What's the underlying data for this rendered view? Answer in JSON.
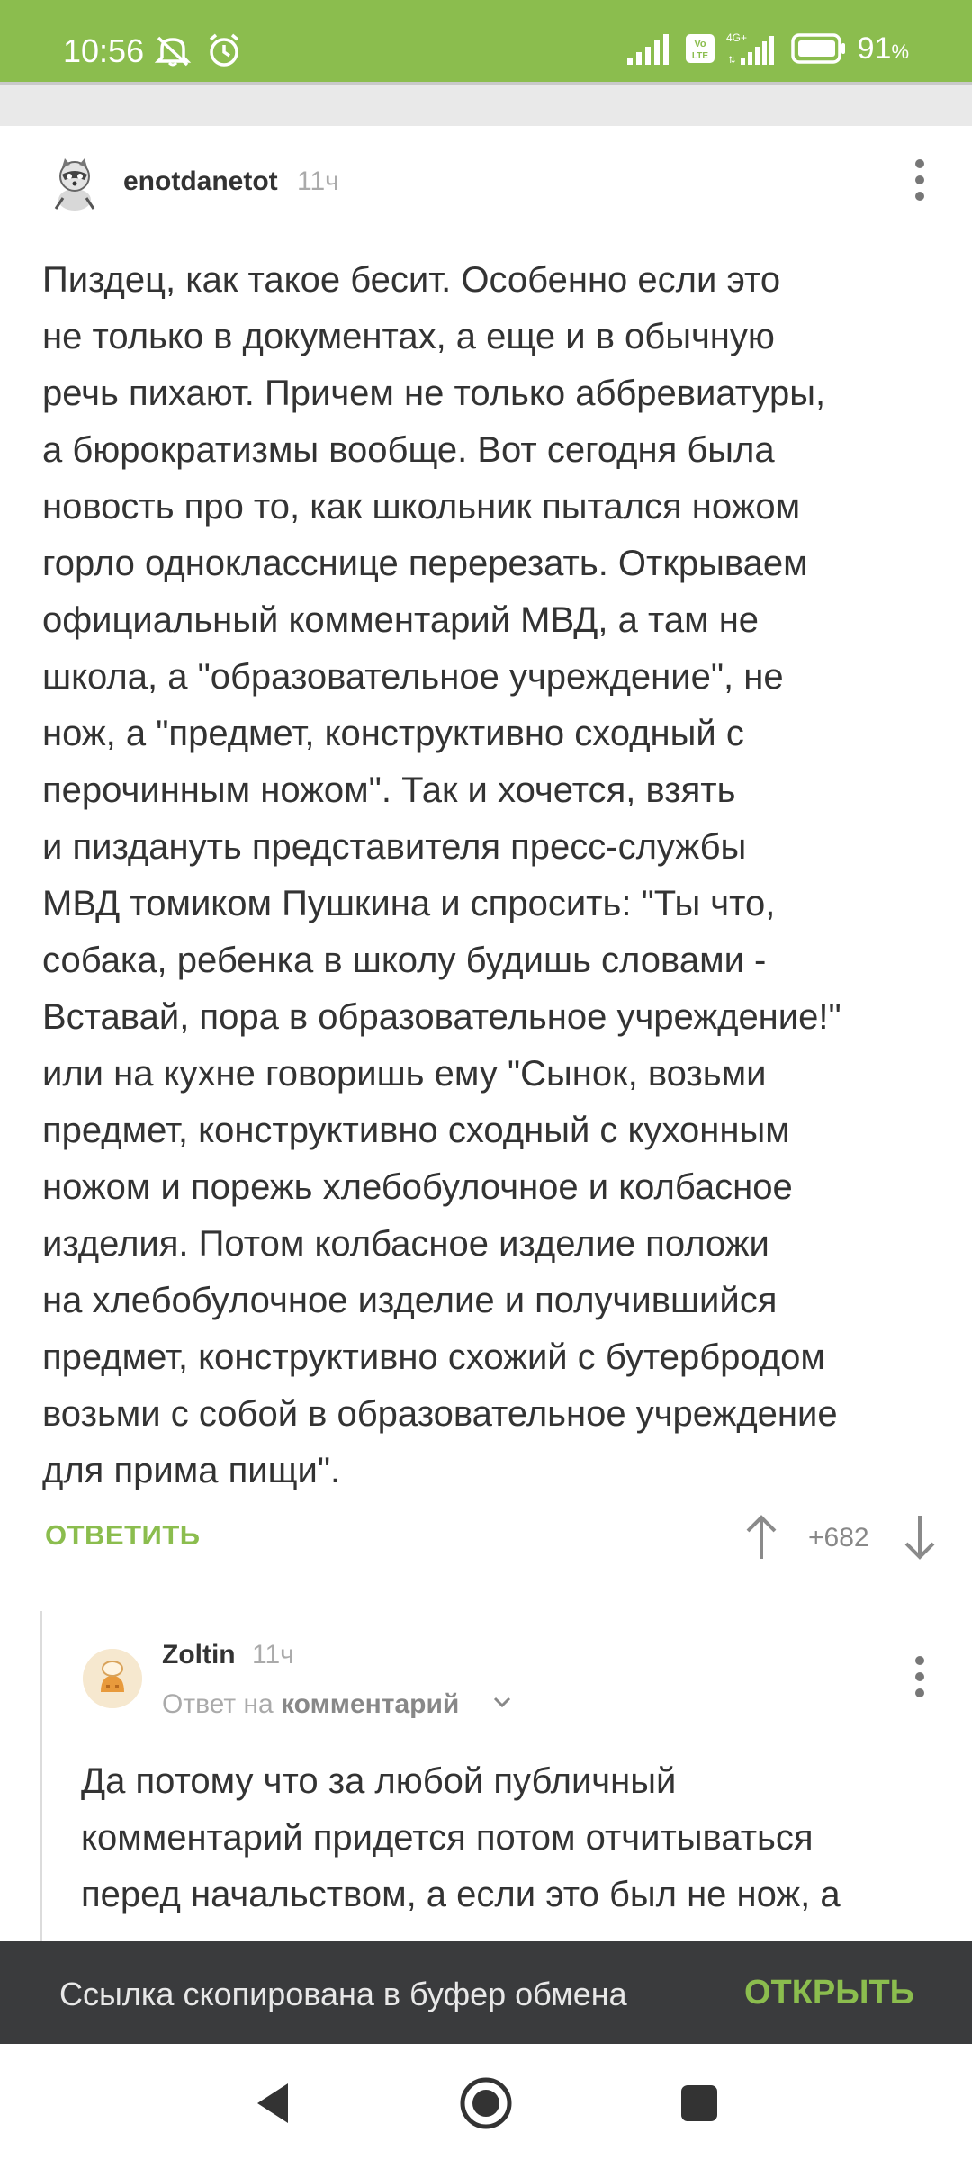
{
  "status_bar": {
    "time": "10:56",
    "battery_percent": "91",
    "battery_unit": "%",
    "network_type": "4G+",
    "volte_label": "Vo LTE",
    "accent_color": "#8bbd4e"
  },
  "comment": {
    "username": "enotdanetot",
    "time_ago": "11ч",
    "text": "Пиздец, как такое бесит. Особенно если это\nне только в документах, а еще и в обычную\nречь пихают. Причем не только аббревиатуры,\nа бюрократизмы вообще. Вот сегодня была\nновость про то, как школьник пытался ножом\nгорло однокласснице перерезать. Открываем\nофициальный комментарий МВД, а там не\nшкола, а \"образовательное учреждение\", не\nнож, а \"предмет, конструктивно сходный с\nперочинным ножом\". Так и хочется, взять\nи пиздануть представителя пресс-службы\nМВД томиком Пушкина и спросить: \"Ты что,\nсобака, ребенка в школу будишь словами -\nВставай, пора в образовательное учреждение!\"\nили на кухне говоришь ему \"Сынок, возьми\nпредмет, конструктивно сходный с кухонным\nножом и порежь хлебобулочное и колбасное\nизделия. Потом колбасное изделие положи\nна хлебобулочное изделие и получившийся\nпредмет, конструктивно схожий с бутербродом\nвозьми с собой в образовательное учреждение\nдля прима пищи\".",
    "reply_label": "ОТВЕТИТЬ",
    "rating": "+682"
  },
  "reply_comment": {
    "username": "Zoltin",
    "time_ago": "11ч",
    "reply_prefix": "Ответ на",
    "reply_target": "комментарий",
    "text": "Да потому что за любой публичный\nкомментарий придется потом отчитываться\nперед начальством, а если это был не нож, а"
  },
  "snackbar": {
    "message": "Ссылка скопирована в буфер обмена",
    "action_label": "ОТКРЫТЬ"
  }
}
